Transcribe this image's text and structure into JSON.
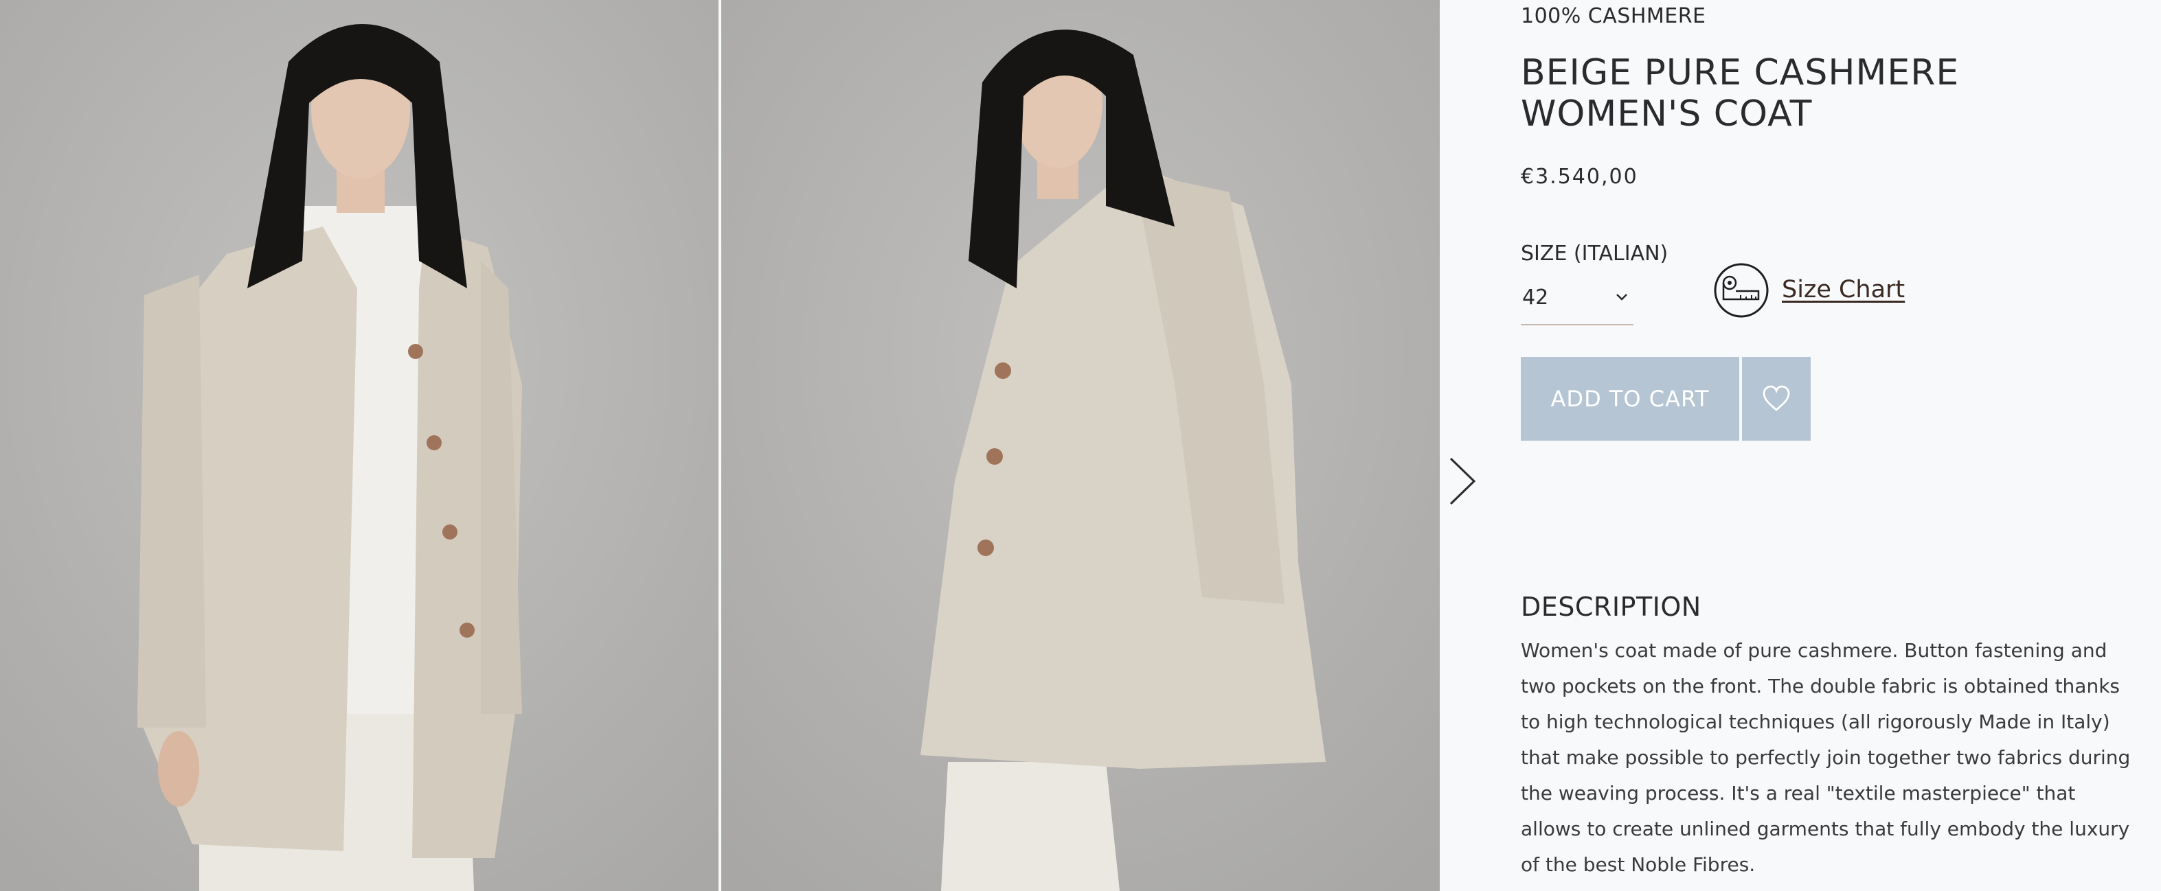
{
  "product": {
    "eyebrow": "100% CASHMERE",
    "title": "BEIGE PURE CASHMERE WOMEN'S COAT",
    "price": "€3.540,00"
  },
  "size": {
    "label": "SIZE (ITALIAN)",
    "selected": "42",
    "chart_link": "Size Chart"
  },
  "actions": {
    "add_to_cart": "ADD TO CART"
  },
  "description": {
    "heading": "DESCRIPTION",
    "body": "Women's coat made of pure cashmere. Button fastening and two pockets on the front. The double fabric is obtained thanks to high technological techniques (all rigorously Made in Italy) that make possible to perfectly join together two fabrics during the weaving process. It's a real \"textile masterpiece\" that allows to create unlined garments that fully embody the luxury of the best Noble Fibres."
  },
  "gallery": {
    "icons": {
      "next": "chevron-right-icon",
      "wishlist": "heart-icon",
      "size_chart": "measuring-tape-icon",
      "size_select": "chevron-down-icon"
    }
  },
  "colors": {
    "button_bg": "#b6c5d4",
    "panel_bg": "#f8f9fb",
    "photo_bg": "#b7b6b4",
    "coat": "#d8d1c5"
  }
}
